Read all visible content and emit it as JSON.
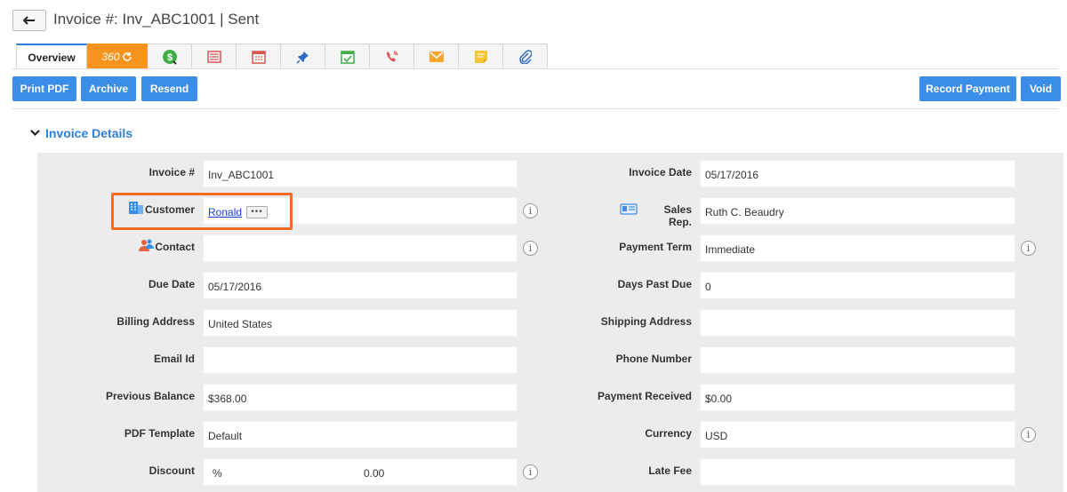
{
  "header": {
    "title": "Invoice #: Inv_ABC1001 | Sent",
    "back_icon": "back-arrow-icon"
  },
  "tabs": [
    {
      "label": "Overview",
      "icon": ""
    },
    {
      "label": "360",
      "icon": "refresh-icon"
    },
    {
      "label": "",
      "icon": "dollar-icon"
    },
    {
      "label": "",
      "icon": "invoice-icon"
    },
    {
      "label": "",
      "icon": "calendar-icon"
    },
    {
      "label": "",
      "icon": "pin-icon"
    },
    {
      "label": "",
      "icon": "task-check-icon"
    },
    {
      "label": "",
      "icon": "phone-call-icon"
    },
    {
      "label": "",
      "icon": "email-icon"
    },
    {
      "label": "",
      "icon": "note-icon"
    },
    {
      "label": "",
      "icon": "paperclip-icon"
    }
  ],
  "toolbar": {
    "print_pdf": "Print PDF",
    "archive": "Archive",
    "resend": "Resend",
    "record_payment": "Record Payment",
    "void": "Void"
  },
  "section": {
    "title": "Invoice Details"
  },
  "fields": {
    "invoice_no": {
      "label": "Invoice #",
      "value": "Inv_ABC1001"
    },
    "invoice_date": {
      "label": "Invoice Date",
      "value": "05/17/2016"
    },
    "customer": {
      "label": "Customer",
      "value": "Ronald",
      "more": "•••"
    },
    "sales_rep": {
      "label": "Sales Rep.",
      "value": "Ruth C. Beaudry"
    },
    "contact": {
      "label": "Contact",
      "value": ""
    },
    "payment_term": {
      "label": "Payment Term",
      "value": "Immediate"
    },
    "due_date": {
      "label": "Due Date",
      "value": "05/17/2016"
    },
    "days_past_due": {
      "label": "Days Past Due",
      "value": "0"
    },
    "billing_address": {
      "label": "Billing Address",
      "value": "United States"
    },
    "shipping_address": {
      "label": "Shipping Address",
      "value": ""
    },
    "email_id": {
      "label": "Email Id",
      "value": ""
    },
    "phone_number": {
      "label": "Phone Number",
      "value": ""
    },
    "previous_balance": {
      "label": "Previous Balance",
      "value": "$368.00"
    },
    "payment_received": {
      "label": "Payment Received",
      "value": "$0.00"
    },
    "pdf_template": {
      "label": "PDF Template",
      "value": "Default"
    },
    "currency": {
      "label": "Currency",
      "value": "USD"
    },
    "discount": {
      "label": "Discount",
      "unit": "%",
      "value": "0.00"
    },
    "late_fee": {
      "label": "Late Fee",
      "value": ""
    }
  },
  "info_glyph": "i",
  "colors": {
    "accent_blue": "#3b8ee8",
    "tab_360_orange": "#f7941d",
    "highlight_orange": "#f26c22",
    "link_blue": "#1a3fd6",
    "panel_gray": "#ececec"
  }
}
